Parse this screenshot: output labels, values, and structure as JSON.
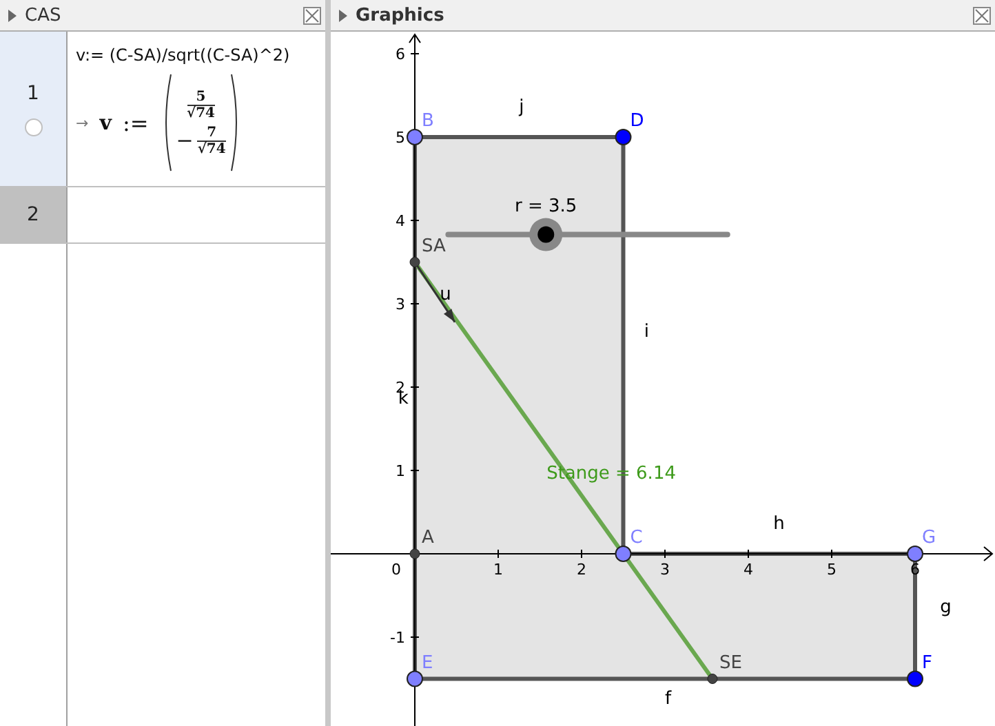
{
  "cas": {
    "title": "CAS",
    "rows": [
      {
        "number": "1",
        "selected": true,
        "shown": false,
        "input": "v:= (C-SA)/sqrt((C-SA)^2)",
        "output": {
          "arrow": "→",
          "name": "v",
          "assign": ":=",
          "entries": [
            {
              "num": "5",
              "den": "√74"
            },
            {
              "sign": "−",
              "num": "7",
              "den": "√74"
            }
          ]
        }
      },
      {
        "number": "2",
        "selected": false
      }
    ]
  },
  "graphics": {
    "title": "Graphics",
    "x_ticks": [
      "1",
      "2",
      "3",
      "4",
      "5",
      "6"
    ],
    "y_ticks": [
      "6",
      "5",
      "4",
      "3",
      "2",
      "1",
      "-1"
    ],
    "origin_label": "0",
    "segments": [
      "j",
      "i",
      "h",
      "g",
      "f",
      "k"
    ],
    "points": [
      {
        "name": "B",
        "color": "#7f7fff"
      },
      {
        "name": "D",
        "color": "#0000ff"
      },
      {
        "name": "SA",
        "color": "#444444"
      },
      {
        "name": "A",
        "color": "#444444"
      },
      {
        "name": "C",
        "color": "#7f7fff"
      },
      {
        "name": "G",
        "color": "#7f7fff"
      },
      {
        "name": "E",
        "color": "#7f7fff"
      },
      {
        "name": "SE",
        "color": "#444444"
      },
      {
        "name": "F",
        "color": "#0000ff"
      }
    ],
    "stange": {
      "label": "Stange = 6.14"
    },
    "vector": {
      "label": "u"
    },
    "slider": {
      "label": "r = 3.5",
      "level": 0.35
    }
  }
}
